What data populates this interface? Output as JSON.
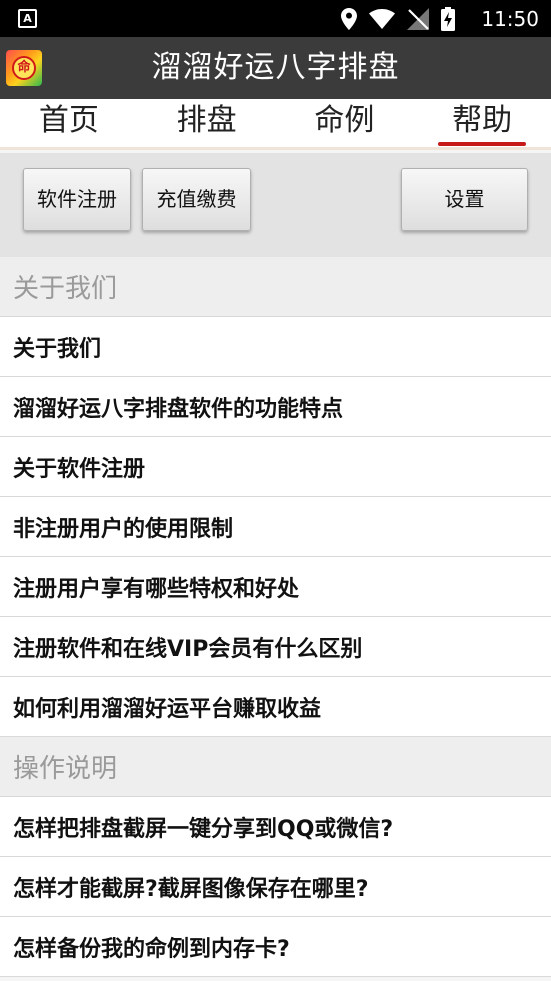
{
  "status_bar": {
    "app_icon_letter": "A",
    "time": "11:50"
  },
  "app": {
    "logo_char": "命",
    "title": "溜溜好运八字排盘"
  },
  "tabs": [
    {
      "label": "首页"
    },
    {
      "label": "排盘"
    },
    {
      "label": "命例"
    },
    {
      "label": "帮助"
    }
  ],
  "active_tab": "帮助",
  "toolbar": {
    "register_label": "软件注册",
    "recharge_label": "充值缴费",
    "settings_label": "设置"
  },
  "sections": [
    {
      "header": "关于我们",
      "items": [
        "关于我们",
        "溜溜好运八字排盘软件的功能特点",
        "关于软件注册",
        "非注册用户的使用限制",
        "注册用户享有哪些特权和好处",
        "注册软件和在线VIP会员有什么区别",
        "如何利用溜溜好运平台赚取收益"
      ]
    },
    {
      "header": "操作说明",
      "items": [
        "怎样把排盘截屏一键分享到QQ或微信?",
        "怎样才能截屏?截屏图像保存在哪里?",
        "怎样备份我的命例到内存卡?"
      ]
    }
  ],
  "colors": {
    "title_bar": "#3b3b3b",
    "tab_indicator": "#c61a1a",
    "toolbar_bg": "#e3e3e3"
  }
}
